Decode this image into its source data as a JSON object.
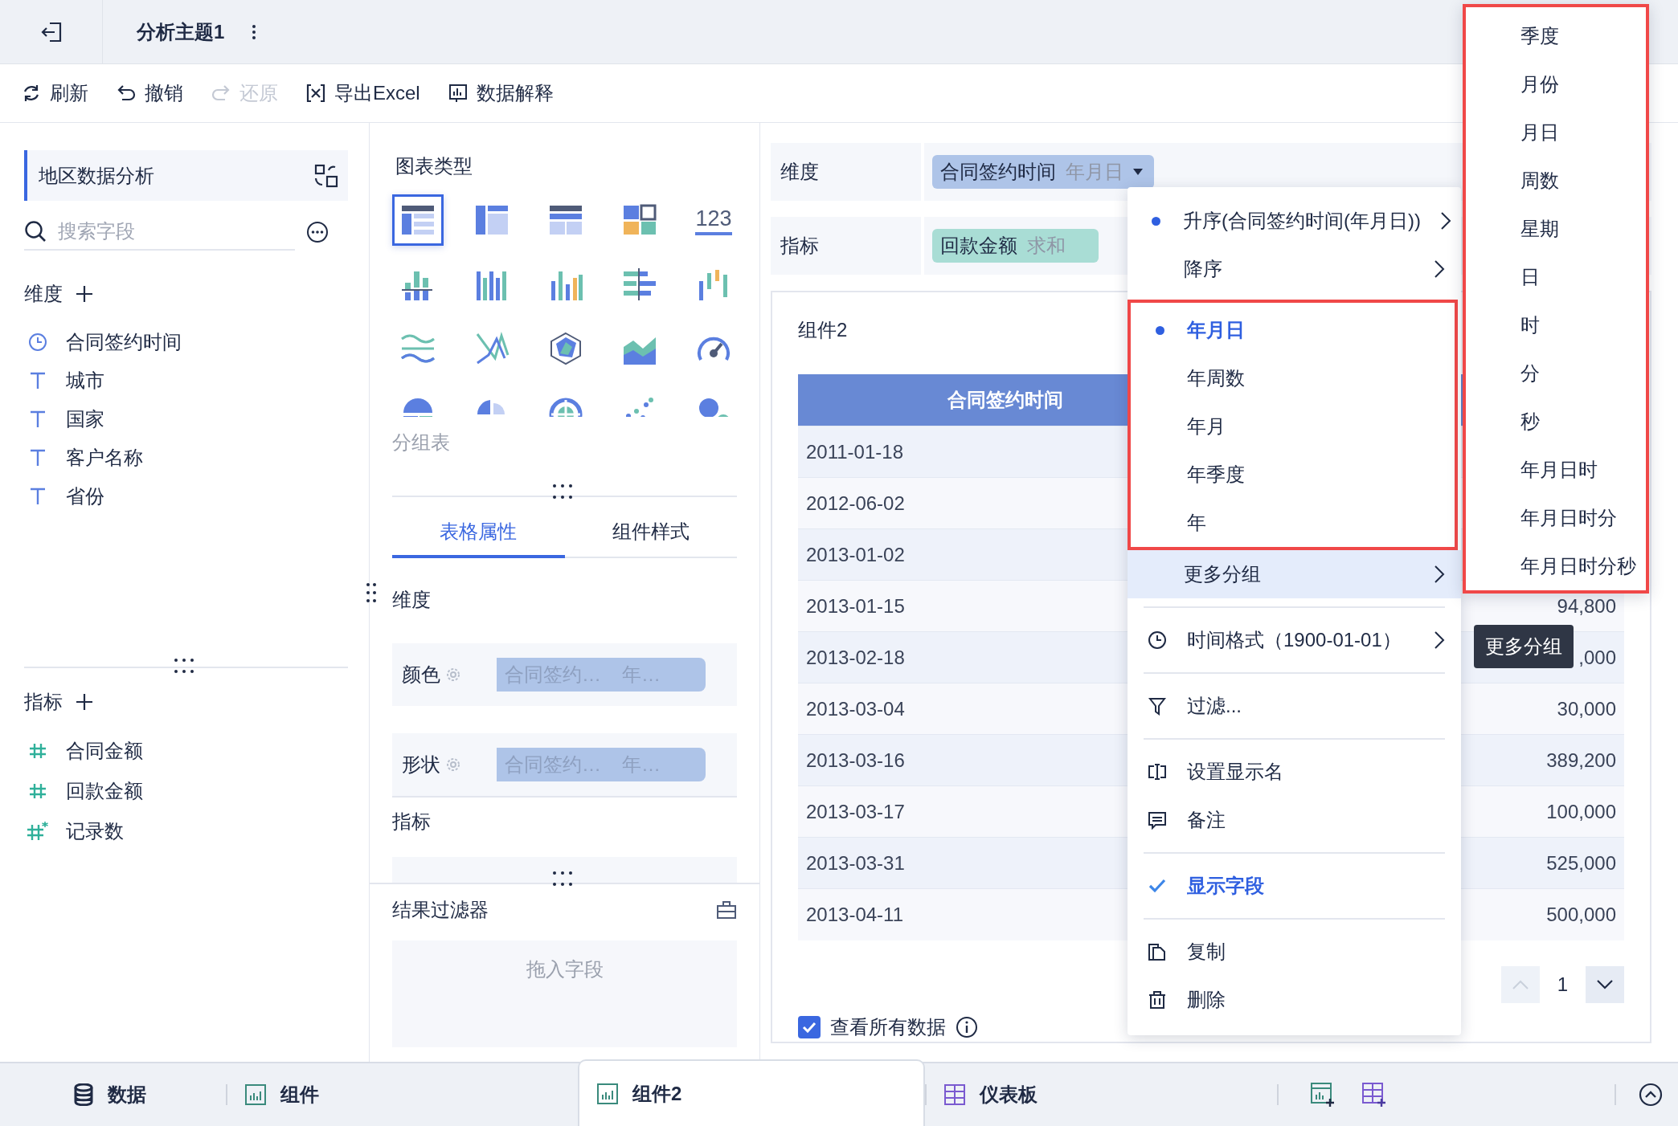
{
  "header": {
    "title": "分析主题1"
  },
  "toolbar": [
    {
      "label": "刷新",
      "disabled": false
    },
    {
      "label": "撤销",
      "disabled": false
    },
    {
      "label": "还原",
      "disabled": true
    },
    {
      "label": "导出Excel",
      "disabled": false
    },
    {
      "label": "数据解释",
      "disabled": false
    }
  ],
  "data_panel": {
    "dataset": "地区数据分析",
    "search": {
      "placeholder": "搜索字段"
    },
    "dimensions": {
      "title": "维度",
      "fields": [
        {
          "name": "合同签约时间",
          "kind": "date"
        },
        {
          "name": "城市",
          "kind": "text"
        },
        {
          "name": "国家",
          "kind": "text"
        },
        {
          "name": "客户名称",
          "kind": "text"
        },
        {
          "name": "省份",
          "kind": "text"
        }
      ]
    },
    "measures": {
      "title": "指标",
      "fields": [
        {
          "name": "合同金额",
          "kind": "number"
        },
        {
          "name": "回款金额",
          "kind": "number"
        },
        {
          "name": "记录数",
          "kind": "count"
        }
      ]
    }
  },
  "chart_panel": {
    "title": "图表类型",
    "chart_types": [
      {
        "kind": "group-table",
        "selected": true
      },
      {
        "kind": "cross-table",
        "selected": false
      },
      {
        "kind": "detail-table",
        "selected": false
      },
      {
        "kind": "tiles",
        "selected": false
      },
      {
        "kind": "kpi",
        "text": "123",
        "selected": false
      },
      {
        "kind": "stacked-column",
        "selected": false
      },
      {
        "kind": "grouped-column",
        "selected": false
      },
      {
        "kind": "column",
        "selected": false
      },
      {
        "kind": "bar",
        "selected": false
      },
      {
        "kind": "range-column",
        "selected": false
      },
      {
        "kind": "line",
        "selected": false
      },
      {
        "kind": "crossing-line",
        "selected": false
      },
      {
        "kind": "radar",
        "selected": false
      },
      {
        "kind": "area",
        "selected": false
      },
      {
        "kind": "gauge",
        "selected": false
      },
      {
        "kind": "pie",
        "selected": false
      },
      {
        "kind": "rose",
        "selected": false
      },
      {
        "kind": "sunburst",
        "selected": false
      },
      {
        "kind": "scatter",
        "selected": false
      },
      {
        "kind": "bubble",
        "selected": false
      }
    ],
    "selected_label": "分组表",
    "tabs": [
      {
        "label": "表格属性",
        "selected": true
      },
      {
        "label": "组件样式",
        "selected": false
      }
    ],
    "dimension_section": {
      "title": "维度",
      "rows": [
        {
          "label": "颜色",
          "field": "合同签约…",
          "group": "年…"
        },
        {
          "label": "形状",
          "field": "合同签约…",
          "group": "年…"
        }
      ]
    },
    "measure_section": {
      "title": "指标"
    },
    "result_filter": {
      "title": "结果过滤器",
      "placeholder": "拖入字段"
    }
  },
  "editor": {
    "dimension": {
      "label": "维度",
      "field": "合同签约时间",
      "group": "年月日"
    },
    "measure": {
      "label": "指标",
      "field": "回款金额",
      "aggregation": "求和"
    },
    "widget": {
      "title": "组件2",
      "table": {
        "columns": [
          "合同签约时间"
        ],
        "rows": [
          {
            "date": "2011-01-18"
          },
          {
            "date": "2012-06-02"
          },
          {
            "date": "2013-01-02"
          },
          {
            "date": "2013-01-15",
            "value": "94,800"
          },
          {
            "date": "2013-02-18",
            "value": ",000"
          },
          {
            "date": "2013-03-04",
            "value": "30,000"
          },
          {
            "date": "2013-03-16",
            "value": "389,200"
          },
          {
            "date": "2013-03-17",
            "value": "100,000"
          },
          {
            "date": "2013-03-31",
            "value": "525,000"
          },
          {
            "date": "2013-04-11",
            "value": "500,000"
          }
        ]
      },
      "pagination": {
        "page": "1",
        "prev_disabled": true
      },
      "view_all": {
        "label": "查看所有数据",
        "checked": true
      }
    }
  },
  "context_menu": {
    "sort": [
      {
        "label": "升序(合同签约时间(年月日))",
        "selected": true
      },
      {
        "label": "降序",
        "selected": false
      }
    ],
    "grouping": {
      "framed": true,
      "items": [
        {
          "label": "年月日",
          "selected": true
        },
        {
          "label": "年周数",
          "selected": false
        },
        {
          "label": "年月",
          "selected": false
        },
        {
          "label": "年季度",
          "selected": false
        },
        {
          "label": "年",
          "selected": false
        }
      ]
    },
    "more": {
      "label": "更多分组",
      "expanded": true
    },
    "sections": [
      [
        {
          "label": "时间格式（1900-01-01）",
          "submenu": true
        }
      ],
      [
        {
          "label": "过滤...",
          "submenu": false
        }
      ],
      [
        {
          "label": "设置显示名",
          "submenu": false
        },
        {
          "label": "备注",
          "submenu": false
        }
      ],
      [
        {
          "label": "显示字段",
          "checked": true,
          "submenu": false
        }
      ],
      [
        {
          "label": "复制",
          "submenu": false
        },
        {
          "label": "删除",
          "submenu": false
        }
      ]
    ]
  },
  "submenu": {
    "framed": true,
    "items": [
      "季度",
      "月份",
      "月日",
      "周数",
      "星期",
      "日",
      "时",
      "分",
      "秒",
      "年月日时",
      "年月日时分",
      "年月日时分秒"
    ]
  },
  "tooltip": {
    "text": "更多分组"
  },
  "bottom_tabs": [
    {
      "label": "数据",
      "selected": false
    },
    {
      "label": "组件",
      "selected": false
    },
    {
      "label": "组件2",
      "selected": true
    },
    {
      "label": "仪表板",
      "selected": false
    }
  ]
}
